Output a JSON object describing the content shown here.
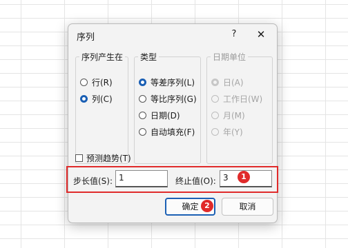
{
  "dialog": {
    "title": "序列",
    "help": "?",
    "close": "✕"
  },
  "series_in": {
    "title": "序列产生在",
    "options": [
      {
        "label": "行(R)",
        "checked": false
      },
      {
        "label": "列(C)",
        "checked": true
      }
    ]
  },
  "type": {
    "title": "类型",
    "options": [
      {
        "label": "等差序列(L)",
        "checked": true
      },
      {
        "label": "等比序列(G)",
        "checked": false
      },
      {
        "label": "日期(D)",
        "checked": false
      },
      {
        "label": "自动填充(F)",
        "checked": false
      }
    ]
  },
  "date_unit": {
    "title": "日期单位",
    "options": [
      {
        "label": "日(A)",
        "checked": true
      },
      {
        "label": "工作日(W)",
        "checked": false
      },
      {
        "label": "月(M)",
        "checked": false
      },
      {
        "label": "年(Y)",
        "checked": false
      }
    ]
  },
  "trend": {
    "label": "预测趋势(T)",
    "checked": false
  },
  "step": {
    "label": "步长值(S):",
    "value": "1"
  },
  "stop": {
    "label": "终止值(O):",
    "value": "3"
  },
  "badges": {
    "one": "1",
    "two": "2"
  },
  "buttons": {
    "ok": "确定",
    "cancel": "取消"
  },
  "colors": {
    "accent": "#1a5fb4",
    "highlight": "#e02a2a"
  }
}
